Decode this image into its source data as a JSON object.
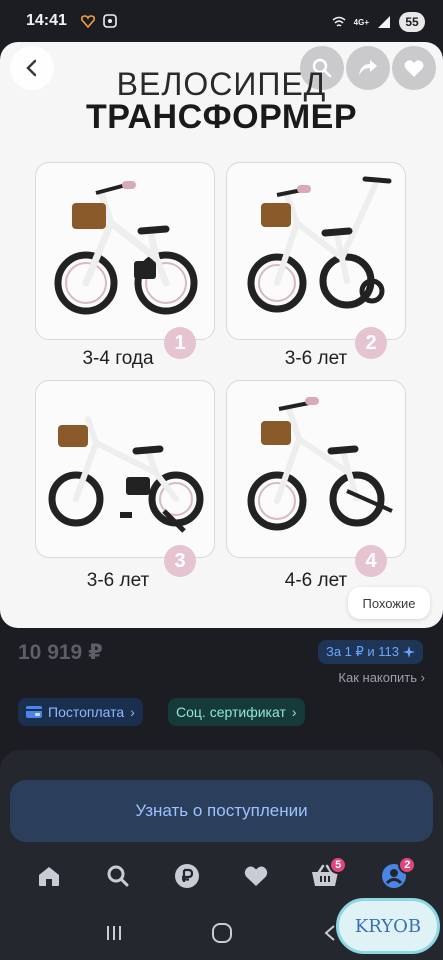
{
  "status": {
    "time": "14:41",
    "network": "4G+",
    "battery": "55"
  },
  "product_image": {
    "title_line1": "ВЕЛОСИПЕД",
    "title_line2": "ТРАНСФОРМЕР",
    "variants": [
      {
        "num": "1",
        "label": "3-4 года"
      },
      {
        "num": "2",
        "label": "3-6 лет"
      },
      {
        "num": "3",
        "label": "3-6 лет"
      },
      {
        "num": "4",
        "label": "4-6 лет"
      }
    ],
    "similar_label": "Похожие"
  },
  "price": {
    "value": "10 919 ₽"
  },
  "bonus": {
    "label": "За 1 ₽ и 113",
    "how_label": "Как накопить"
  },
  "chips": {
    "postpay": "Постоплата",
    "certificate": "Соц. сертификат"
  },
  "sheet": {
    "notify_label": "Узнать о поступлении"
  },
  "tabs": [
    {
      "name": "home-icon"
    },
    {
      "name": "search-icon"
    },
    {
      "name": "ruble-icon"
    },
    {
      "name": "heart-icon"
    },
    {
      "name": "cart-icon",
      "badge": "5"
    },
    {
      "name": "profile-icon",
      "badge": "2"
    }
  ],
  "watermark": "KRYOB",
  "colors": {
    "accent": "#9dc2ff",
    "badge": "#e0457b",
    "variant_circle": "#e5c3d1"
  }
}
